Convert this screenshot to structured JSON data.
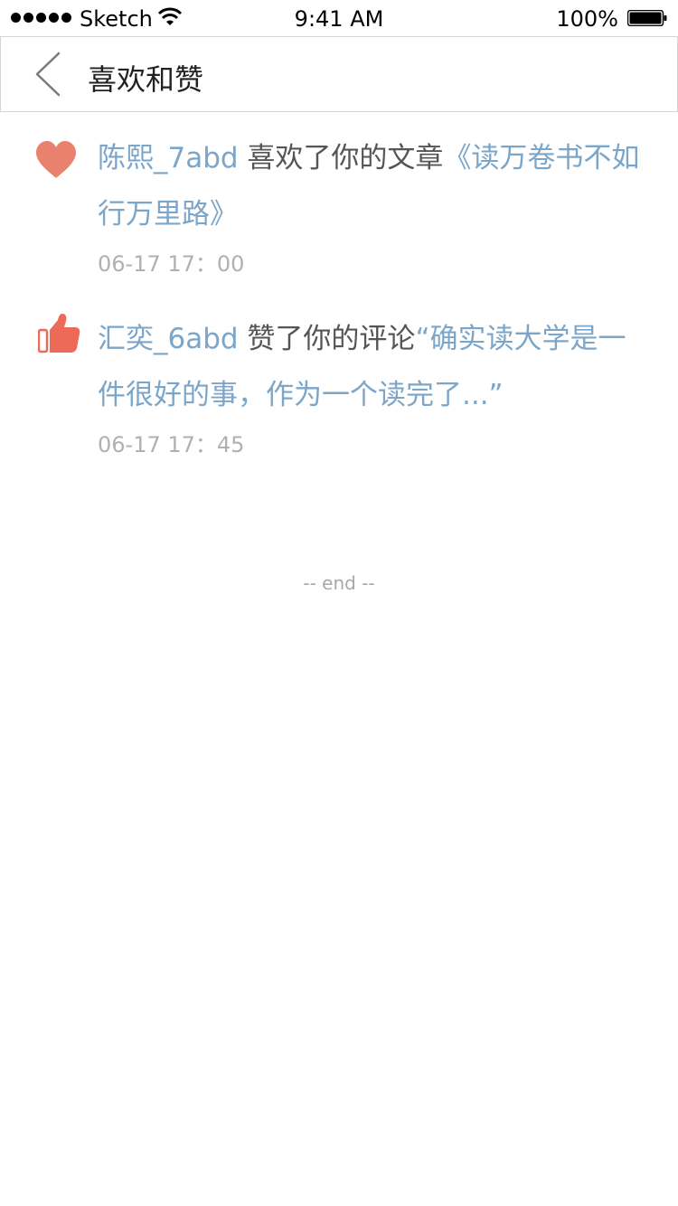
{
  "status_bar": {
    "carrier": "Sketch",
    "time": "9:41 AM",
    "battery_percent": "100%"
  },
  "nav": {
    "title": "喜欢和赞"
  },
  "notifications": [
    {
      "type": "like",
      "icon": "heart-icon",
      "user": "陈熙_7abd",
      "action": " 喜欢了你的文章",
      "target": "《读万卷书不如行万里路》",
      "time": "06-17 17：00"
    },
    {
      "type": "thumbs-up",
      "icon": "thumbs-up-icon",
      "user": "汇奕_6abd",
      "action": " 赞了你的评论",
      "target": "“确实读大学是一件很好的事，作为一个读完了...”",
      "time": "06-17 17：45"
    }
  ],
  "footer": {
    "end_text": "-- end --"
  },
  "colors": {
    "link": "#7ba6c9",
    "heart": "#e8826f",
    "thumb": "#ee6a58",
    "time": "#b0b0b0"
  }
}
